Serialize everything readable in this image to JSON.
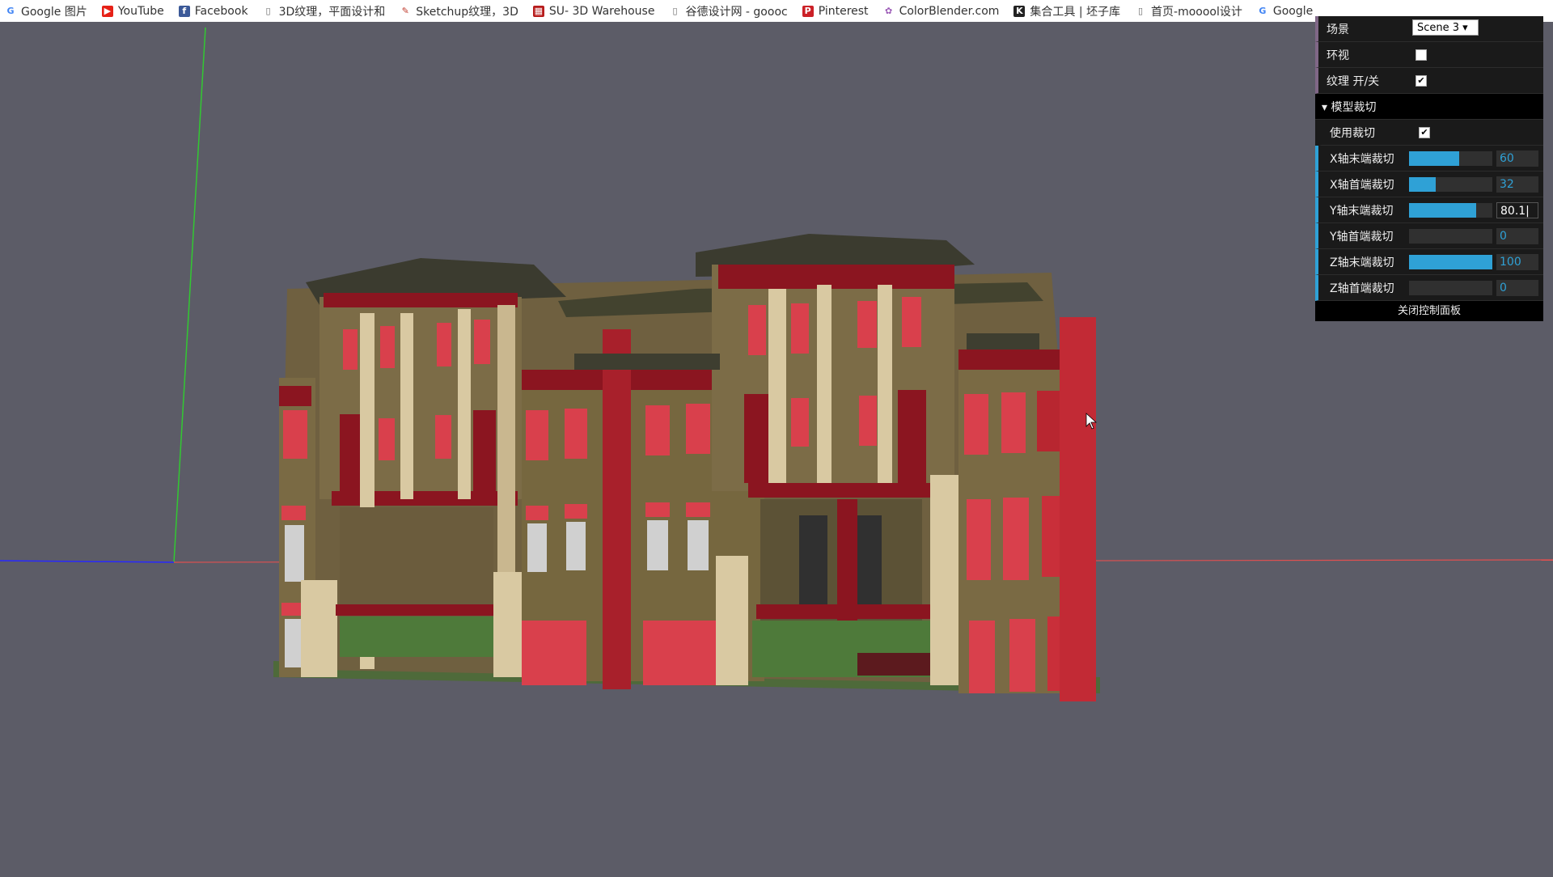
{
  "bookmarks": [
    {
      "label": "Google 图片",
      "icon": "google-icon"
    },
    {
      "label": "YouTube",
      "icon": "youtube-icon"
    },
    {
      "label": "Facebook",
      "icon": "facebook-icon"
    },
    {
      "label": "3D纹理，平面设计和",
      "icon": "page-icon"
    },
    {
      "label": "Sketchup纹理，3D",
      "icon": "sketchup-icon"
    },
    {
      "label": "SU- 3D Warehouse",
      "icon": "warehouse-icon"
    },
    {
      "label": "谷德设计网 - goooc",
      "icon": "page-icon"
    },
    {
      "label": "Pinterest",
      "icon": "pinterest-icon"
    },
    {
      "label": "ColorBlender.com",
      "icon": "colorblender-icon"
    },
    {
      "label": "集合工具 | 坯子库",
      "icon": "tool-icon"
    },
    {
      "label": "首页-mooool设计",
      "icon": "page-icon"
    },
    {
      "label": "Google",
      "icon": "google-icon"
    }
  ],
  "panel": {
    "scene_label": "场景",
    "scene_value": "Scene 3 ▾",
    "orbit_label": "环视",
    "orbit_checked": "",
    "texture_label": "纹理 开/关",
    "texture_checked": "✔",
    "folder_title": "▾ 模型裁切",
    "use_clip_label": "使用裁切",
    "use_clip_checked": "✔",
    "sliders": [
      {
        "label": "X轴末端裁切",
        "value": "60",
        "fraction": 0.6
      },
      {
        "label": "X轴首端裁切",
        "value": "32",
        "fraction": 0.32
      },
      {
        "label": "Y轴末端裁切",
        "value": "80.1|",
        "fraction": 0.801
      },
      {
        "label": "Y轴首端裁切",
        "value": "0",
        "fraction": 0
      },
      {
        "label": "Z轴末端裁切",
        "value": "100",
        "fraction": 1.0
      },
      {
        "label": "Z轴首端裁切",
        "value": "0",
        "fraction": 0
      }
    ],
    "close_label": "关闭控制面板"
  },
  "colors": {
    "background": "#5c5c67",
    "accent": "#2fa1d6",
    "building_red": "#d83a45",
    "building_dark": "#3a3a2e",
    "building_tan": "#7a6a44"
  }
}
